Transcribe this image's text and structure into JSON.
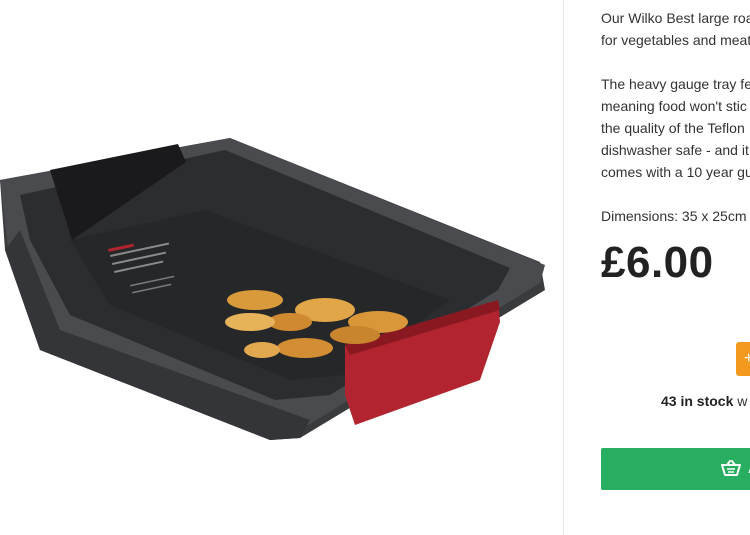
{
  "product": {
    "description_lines": [
      "Our Wilko Best large roa",
      "for vegetables and meat",
      "",
      "The heavy gauge tray fe",
      "meaning food won't stic",
      "the quality of the Teflon",
      "dishwasher safe - and it",
      "comes with a 10 year gu"
    ],
    "dimensions": "Dimensions: 35 x 25cm",
    "price": "£6.00",
    "stock_count": "43 in stock",
    "stock_suffix": " w",
    "quantity_button_label": "+",
    "add_to_basket_label": "A"
  },
  "icons": {
    "basket": "basket-icon"
  },
  "colors": {
    "add_button": "#27ae60",
    "quantity_button": "#f39a1e",
    "price_text": "#222222"
  }
}
